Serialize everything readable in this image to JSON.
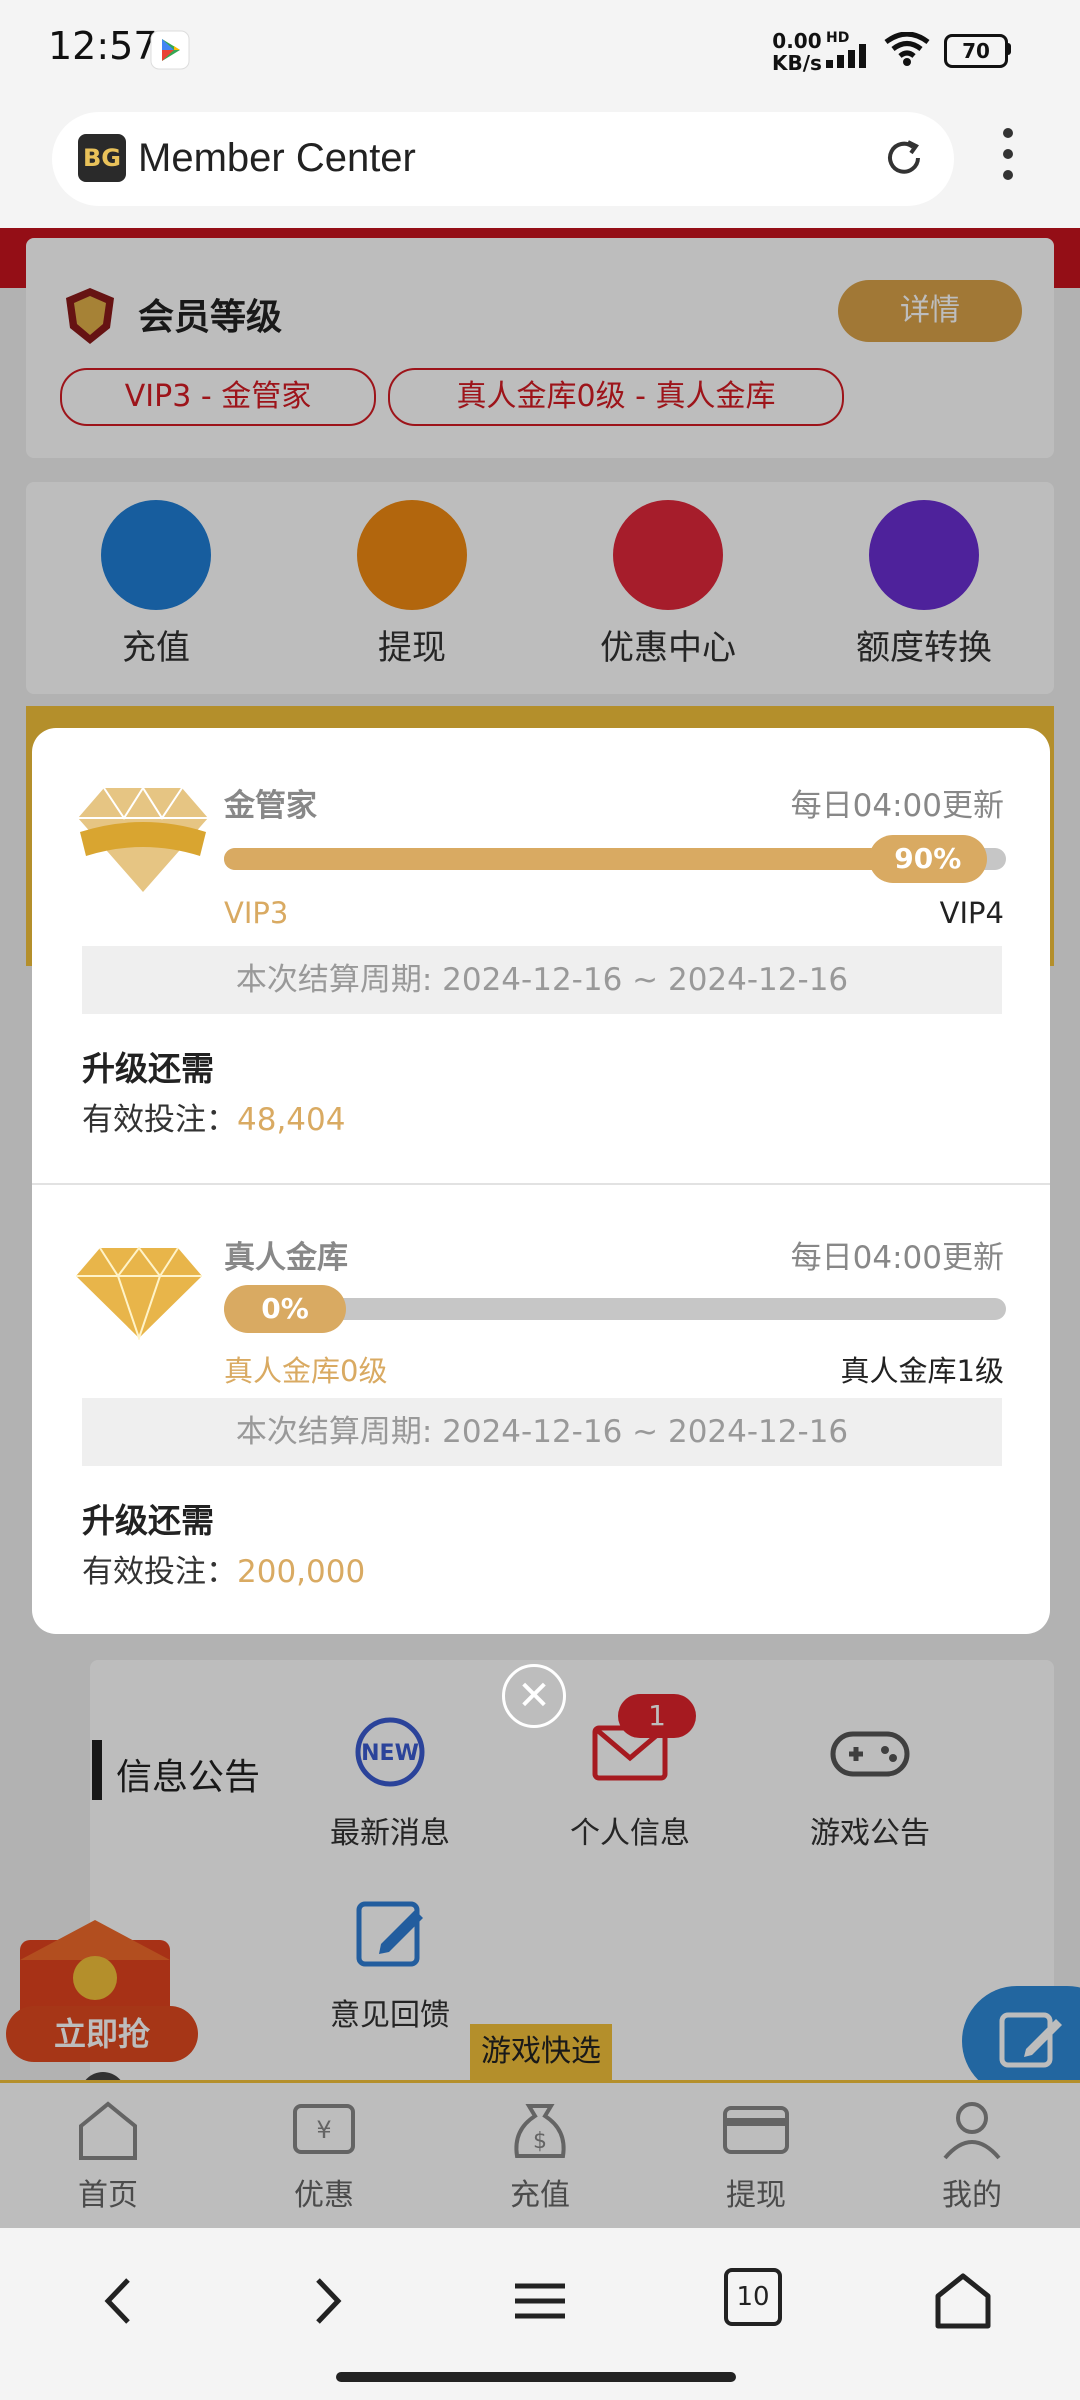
{
  "status_bar": {
    "time": "12:57",
    "net_speed_value": "0.00",
    "net_speed_unit": "KB/s",
    "hd_label": "HD",
    "battery": "70"
  },
  "browser": {
    "page_title": "Member Center",
    "site_icon_text": "BG",
    "open_tabs": "10"
  },
  "member": {
    "title": "会员等级",
    "detail_label": "详情",
    "tags": [
      "VIP3 - 金管家",
      "真人金库0级 - 真人金库"
    ]
  },
  "actions": [
    {
      "label": "充值",
      "icon": "recharge-icon",
      "color": "#1f7ed6"
    },
    {
      "label": "提现",
      "icon": "withdraw-icon",
      "color": "#f08a12"
    },
    {
      "label": "优惠中心",
      "icon": "promo-gift-icon",
      "color": "#e0283a"
    },
    {
      "label": "额度转换",
      "icon": "transfer-icon",
      "color": "#6a2fd1"
    }
  ],
  "notices": {
    "title": "信息公告",
    "items": [
      {
        "label": "最新消息",
        "icon": "new-badge-icon"
      },
      {
        "label": "个人信息",
        "icon": "envelope-icon",
        "badge": "1"
      },
      {
        "label": "游戏公告",
        "icon": "gamepad-icon"
      },
      {
        "label": "意见回馈",
        "icon": "feedback-edit-icon"
      }
    ]
  },
  "promo": {
    "label": "立即抢"
  },
  "quick_game": "游戏快选",
  "tabbar": [
    {
      "label": "首页",
      "icon": "home-icon"
    },
    {
      "label": "优惠",
      "icon": "coupon-icon"
    },
    {
      "label": "充值",
      "icon": "money-bag-icon"
    },
    {
      "label": "提现",
      "icon": "card-icon"
    },
    {
      "label": "我的",
      "icon": "person-icon"
    }
  ],
  "modal": {
    "sections": [
      {
        "name": "金管家",
        "update_note": "每日04:00更新",
        "progress_label": "90%",
        "progress": 0.9,
        "from_level": "VIP3",
        "to_level": "VIP4",
        "period": "本次结算周期: 2024-12-16 ~ 2024-12-16",
        "req_title": "升级还需",
        "req_label": "有效投注：",
        "req_value": "48,404"
      },
      {
        "name": "真人金库",
        "update_note": "每日04:00更新",
        "progress_label": "0%",
        "progress": 0.0,
        "from_level": "真人金库0级",
        "to_level": "真人金库1级",
        "period": "本次结算周期: 2024-12-16 ~ 2024-12-16",
        "req_title": "升级还需",
        "req_label": "有效投注：",
        "req_value": "200,000"
      }
    ],
    "vip_badge_text": "VIP"
  },
  "colors": {
    "accent_gold": "#d9aa62",
    "brand_red": "#c8141e",
    "yellow": "#f3c23a"
  }
}
